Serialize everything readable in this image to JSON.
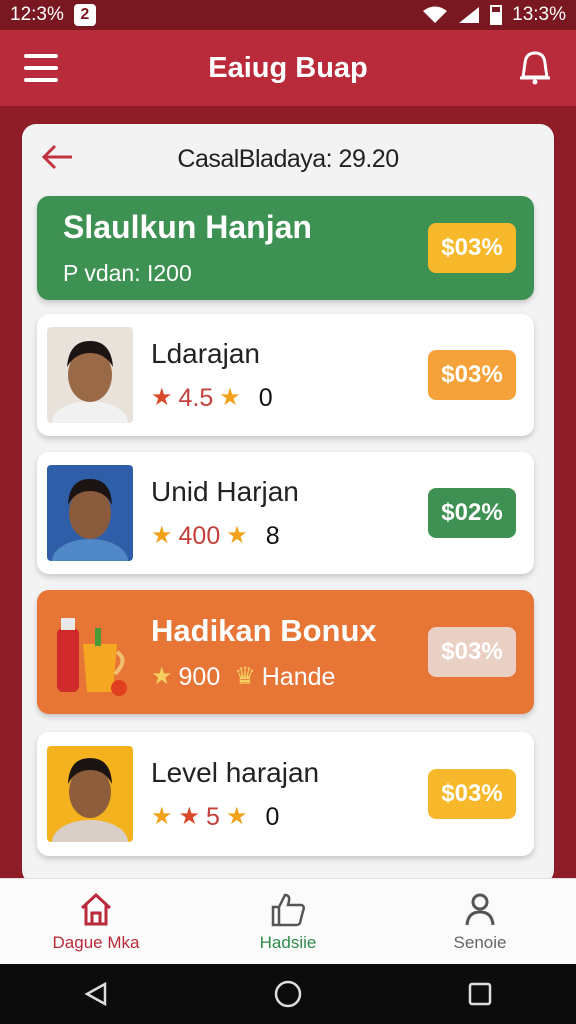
{
  "status": {
    "time_left": "12:3%",
    "sim": "2",
    "time_right": "13:3%"
  },
  "app": {
    "title": "Eaiug Buap"
  },
  "panel": {
    "title": "CasalBladaya: 29.20"
  },
  "featured": {
    "name": "Slaulkun Hanjan",
    "sub": "P vdan: I200",
    "price": "$03%",
    "price_color": "#f7b92b"
  },
  "items": [
    {
      "name": "Ldarajan",
      "rating": "4.5",
      "count": "0",
      "price": "$03%",
      "price_color": "#f6a23a"
    },
    {
      "name": "Unid Harjan",
      "rating": "400",
      "count": "8",
      "price": "$02%",
      "price_color": "#3e9152"
    },
    {
      "name": "Level harajan",
      "rating": "5",
      "count": "0",
      "price": "$03%",
      "price_color": "#f7b92b"
    }
  ],
  "bonus": {
    "name": "Hadikan Bonux",
    "value": "900",
    "tag": "Hande",
    "price": "$03%",
    "price_color": "#e9d0c4"
  },
  "nav": [
    {
      "label": "Dague Mka",
      "icon": "home-icon",
      "color": "#b92a3a"
    },
    {
      "label": "Hadsiie",
      "icon": "thumbs-up-icon",
      "color": "#2f8a4a"
    },
    {
      "label": "Senoie",
      "icon": "person-icon",
      "color": "#666666"
    }
  ],
  "colors": {
    "brand": "#b92a3a",
    "green": "#3d9152",
    "orange": "#e67536"
  }
}
